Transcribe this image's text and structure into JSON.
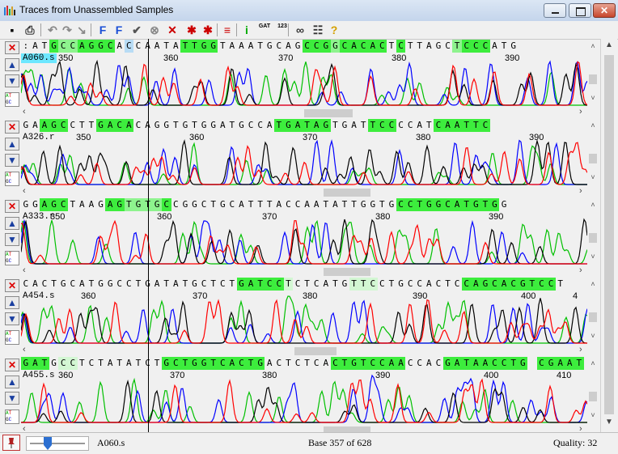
{
  "window": {
    "title": "Traces from Unassembled Samples"
  },
  "toolbar": {
    "buttons": [
      {
        "name": "save-icon",
        "glyph": "▪"
      },
      {
        "name": "print-icon",
        "glyph": "⎙"
      },
      {
        "name": "undo-icon",
        "glyph": "↶"
      },
      {
        "name": "redo-icon",
        "glyph": "↷"
      },
      {
        "name": "cursor-arrow-icon",
        "glyph": "↘"
      },
      {
        "name": "find-forward-icon",
        "glyph": "F"
      },
      {
        "name": "find-backward-icon",
        "glyph": "F"
      },
      {
        "name": "accept-check-icon",
        "glyph": "✔"
      },
      {
        "name": "reject-circle-icon",
        "glyph": "⊗"
      },
      {
        "name": "delete-x-icon",
        "glyph": "✕"
      },
      {
        "name": "prev-asterisk-icon",
        "glyph": "✱"
      },
      {
        "name": "next-asterisk-icon",
        "glyph": "✱"
      },
      {
        "name": "lines-icon",
        "glyph": "≡"
      },
      {
        "name": "info-icon",
        "glyph": "i"
      },
      {
        "name": "translate-icon",
        "glyph": "GAT"
      },
      {
        "name": "numbers-icon",
        "glyph": "123"
      },
      {
        "name": "link-icon",
        "glyph": "∞"
      },
      {
        "name": "list-icon",
        "glyph": "☷"
      },
      {
        "name": "help-icon",
        "glyph": "?"
      }
    ]
  },
  "colors": {
    "highlight_strong": "#3ded3d",
    "highlight_medium": "#8ef38e",
    "highlight_light": "#d3f7d3",
    "sample_selected": "#6de7ff",
    "trace_a": "#00c000",
    "trace_c": "#0000ff",
    "trace_g": "#000000",
    "trace_t": "#ff0000"
  },
  "panels": [
    {
      "sample": "A060.s",
      "selected": true,
      "sequence": ":ATGCCAGGCACCAATATTGGTAAATGCAGCCGGCACACTCTTAGCTCCCATG",
      "highlights": [
        0,
        0,
        0,
        1,
        2,
        2,
        1,
        1,
        1,
        1,
        0,
        3,
        0,
        0,
        0,
        0,
        0,
        1,
        1,
        1,
        1,
        0,
        0,
        0,
        0,
        0,
        0,
        0,
        0,
        0,
        1,
        1,
        1,
        2,
        1,
        1,
        1,
        1,
        1,
        0,
        1,
        0,
        0,
        0,
        0,
        0,
        2,
        1,
        1,
        1,
        0,
        0
      ],
      "cursor_index": 11,
      "positions": [
        {
          "label": "350"
        },
        {
          "label": "360"
        },
        {
          "label": "370"
        },
        {
          "label": "380"
        },
        {
          "label": "390"
        }
      ]
    },
    {
      "sample": "A326.r",
      "selected": false,
      "sequence": "GAAGCCTTGACACAGGTGTGGATGCCATGATAGTGATTCCCCATCAATTC",
      "highlights": [
        0,
        0,
        1,
        1,
        1,
        0,
        0,
        0,
        1,
        1,
        1,
        1,
        0,
        0,
        0,
        0,
        0,
        0,
        0,
        0,
        0,
        0,
        0,
        0,
        0,
        0,
        0,
        1,
        1,
        1,
        1,
        1,
        1,
        0,
        0,
        0,
        0,
        1,
        1,
        1,
        0,
        0,
        0,
        0,
        1,
        1,
        1,
        1,
        1,
        1
      ],
      "cursor_index": 13,
      "positions": [
        {
          "label": "350"
        },
        {
          "label": "360"
        },
        {
          "label": "370"
        },
        {
          "label": "380"
        },
        {
          "label": "390"
        }
      ]
    },
    {
      "sample": "A333.r",
      "selected": false,
      "sequence": "GGAGCTAAGAGTGTGCCGGCTGCATTTACCAATATTGGTGCCTGGCATGTGG",
      "highlights": [
        0,
        0,
        1,
        1,
        1,
        0,
        0,
        0,
        0,
        1,
        1,
        2,
        2,
        2,
        2,
        1,
        0,
        0,
        0,
        0,
        0,
        0,
        0,
        0,
        0,
        0,
        0,
        0,
        0,
        0,
        0,
        0,
        0,
        0,
        0,
        0,
        0,
        0,
        0,
        0,
        1,
        1,
        1,
        1,
        1,
        1,
        1,
        1,
        1,
        1,
        1,
        0
      ],
      "cursor_index": 12,
      "positions": [
        {
          "label": "350"
        },
        {
          "label": "360"
        },
        {
          "label": "370"
        },
        {
          "label": "380"
        },
        {
          "label": "390"
        }
      ]
    },
    {
      "sample": "A454.s",
      "selected": false,
      "sequence": "CACTGCATGGCCTGATATGCTCTGATCCTCTCATGTTCCTGCCACTCCAGCACGTCCT",
      "highlights": [
        0,
        0,
        0,
        0,
        0,
        0,
        0,
        0,
        0,
        0,
        0,
        0,
        0,
        0,
        0,
        0,
        0,
        0,
        0,
        0,
        0,
        0,
        0,
        1,
        1,
        1,
        1,
        1,
        3,
        0,
        0,
        0,
        0,
        0,
        0,
        3,
        3,
        3,
        0,
        0,
        0,
        0,
        0,
        0,
        0,
        0,
        0,
        1,
        1,
        1,
        1,
        1,
        1,
        1,
        1,
        1,
        1,
        0
      ],
      "cursor_index": 12,
      "positions": [
        {
          "label": "360"
        },
        {
          "label": "370"
        },
        {
          "label": "380"
        },
        {
          "label": "390"
        },
        {
          "label": "400"
        },
        {
          "label": "4"
        }
      ]
    },
    {
      "sample": "A455.s",
      "selected": false,
      "sequence": "GATGCCTCTATATCTGCTGGTCACTGACTCTCACTGTCCAACCACGATAACCTG CGAAT",
      "highlights": [
        1,
        1,
        1,
        0,
        3,
        3,
        0,
        0,
        0,
        0,
        0,
        0,
        0,
        0,
        0,
        1,
        1,
        1,
        1,
        1,
        1,
        1,
        1,
        1,
        1,
        1,
        0,
        0,
        0,
        0,
        0,
        0,
        0,
        1,
        1,
        1,
        1,
        1,
        1,
        1,
        1,
        0,
        0,
        0,
        0,
        1,
        1,
        1,
        1,
        1,
        1,
        1,
        1,
        1,
        0,
        1,
        1,
        1,
        1,
        1
      ],
      "cursor_index": 13,
      "positions": [
        {
          "label": "360"
        },
        {
          "label": "370"
        },
        {
          "label": "380"
        },
        {
          "label": "390"
        },
        {
          "label": "400"
        },
        {
          "label": "410"
        }
      ]
    }
  ],
  "status": {
    "sample": "A060.s",
    "base": "Base 357 of 628",
    "quality": "Quality: 32",
    "slider_value": 0.27
  }
}
